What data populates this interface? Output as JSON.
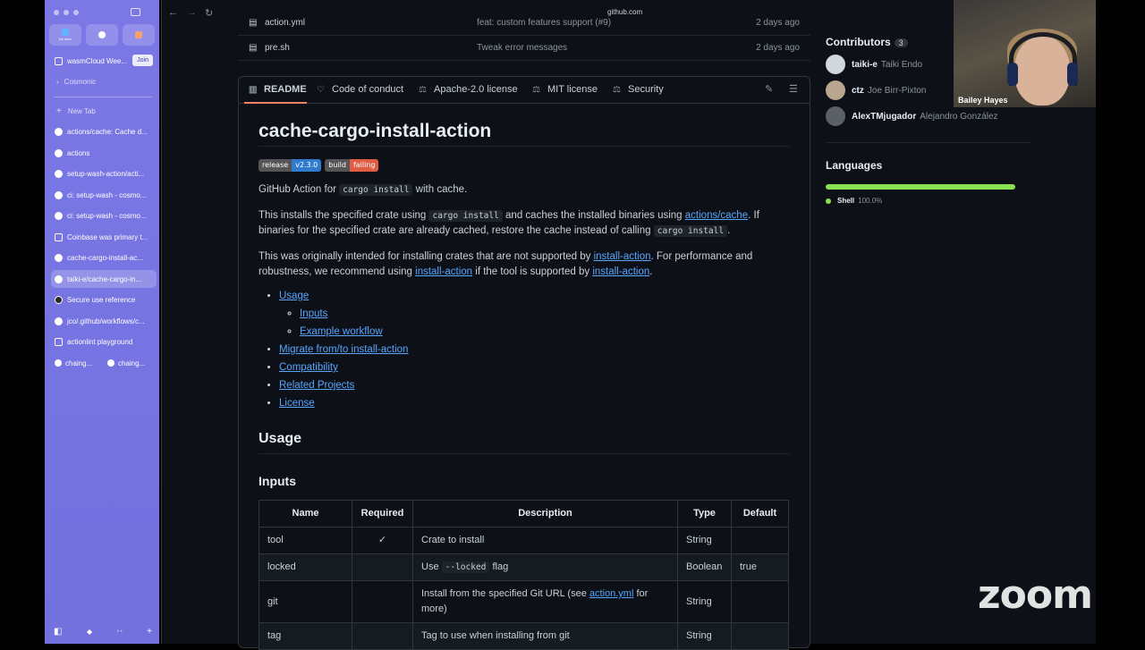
{
  "sidebar": {
    "favorites": [
      {
        "label": "for men",
        "color": "#5fb3ff"
      },
      {
        "label": "",
        "color": "#ffffff"
      },
      {
        "label": "",
        "color": "#f5a16b"
      }
    ],
    "pinned": [
      {
        "label": "wasmCloud Wee...",
        "action": "Join"
      },
      {
        "label": "Cosmonic"
      }
    ],
    "new_tab": "New Tab",
    "tabs": [
      {
        "label": "actions/cache: Cache d..."
      },
      {
        "label": "actions"
      },
      {
        "label": "setup-wash-action/acti..."
      },
      {
        "label": "ci: setup-wash - cosmo..."
      },
      {
        "label": "ci: setup-wash - cosmo..."
      },
      {
        "label": "Coinbase was primary t..."
      },
      {
        "label": "cache-cargo-install-ac..."
      },
      {
        "label": "taiki-e/cache-cargo-in..."
      },
      {
        "label": "Secure use reference"
      },
      {
        "label": "jco/.github/workflows/c..."
      },
      {
        "label": "actionlint playground"
      }
    ],
    "split_tabs": [
      "chaing...",
      "chaing..."
    ]
  },
  "browser": {
    "url": "github.com"
  },
  "files": [
    {
      "name": "action.yml",
      "message": "feat: custom features support (#9)",
      "date": "2 days ago"
    },
    {
      "name": "pre.sh",
      "message": "Tweak error messages",
      "date": "2 days ago"
    }
  ],
  "readme_tabs": [
    "README",
    "Code of conduct",
    "Apache-2.0 license",
    "MIT license",
    "Security"
  ],
  "readme": {
    "title": "cache-cargo-install-action",
    "badges": [
      {
        "left": "release",
        "right": "v2.3.0",
        "color": "#2f7ccf"
      },
      {
        "left": "build",
        "right": "failing",
        "color": "#e05d44"
      }
    ],
    "p1": {
      "a": "GitHub Action for ",
      "code": "cargo install",
      "b": " with cache."
    },
    "p2": {
      "a": "This installs the specified crate using ",
      "code1": "cargo install",
      "b": " and caches the installed binaries using ",
      "link": "actions/cache",
      "c": ". If binaries for the specified crate are already cached, restore the cache instead of calling ",
      "code2": "cargo install",
      "d": "."
    },
    "p3": {
      "a": "This was originally intended for installing crates that are not supported by ",
      "link1": "install-action",
      "b": ". For performance and robustness, we recommend using ",
      "link2": "install-action",
      "c": " if the tool is supported by ",
      "link3": "install-action",
      "d": "."
    },
    "toc": {
      "usage": "Usage",
      "inputs": "Inputs",
      "example": "Example workflow",
      "migrate": "Migrate from/to install-action",
      "compat": "Compatibility",
      "related": "Related Projects",
      "license": "License"
    },
    "h_usage": "Usage",
    "h_inputs": "Inputs",
    "table": {
      "headers": [
        "Name",
        "Required",
        "Description",
        "Type",
        "Default"
      ],
      "rows": [
        {
          "name": "tool",
          "required": "✓",
          "desc_a": "Crate to install",
          "type": "String",
          "default": ""
        },
        {
          "name": "locked",
          "required": "",
          "desc_a": "Use ",
          "desc_code": "--locked",
          "desc_b": " flag",
          "type": "Boolean",
          "default": "true"
        },
        {
          "name": "git",
          "required": "",
          "desc_a": "Install from the specified Git URL (see ",
          "desc_link": "action.yml",
          "desc_b": " for more)",
          "type": "String",
          "default": ""
        },
        {
          "name": "tag",
          "required": "",
          "desc_a": "Tag to use when installing from git",
          "type": "String",
          "default": ""
        }
      ]
    }
  },
  "contributors": {
    "heading": "Contributors",
    "count": "3",
    "people": [
      {
        "login": "taiki-e",
        "name": "Taiki Endo"
      },
      {
        "login": "ctz",
        "name": "Joe Birr-Pixton"
      },
      {
        "login": "AlexTMjugador",
        "name": "Alejandro González"
      }
    ]
  },
  "languages": {
    "heading": "Languages",
    "items": [
      {
        "name": "Shell",
        "percent": "100.0%",
        "color": "#89e051"
      }
    ]
  },
  "webcam": {
    "name": "Bailey Hayes"
  },
  "zoom_watermark": "zoom"
}
